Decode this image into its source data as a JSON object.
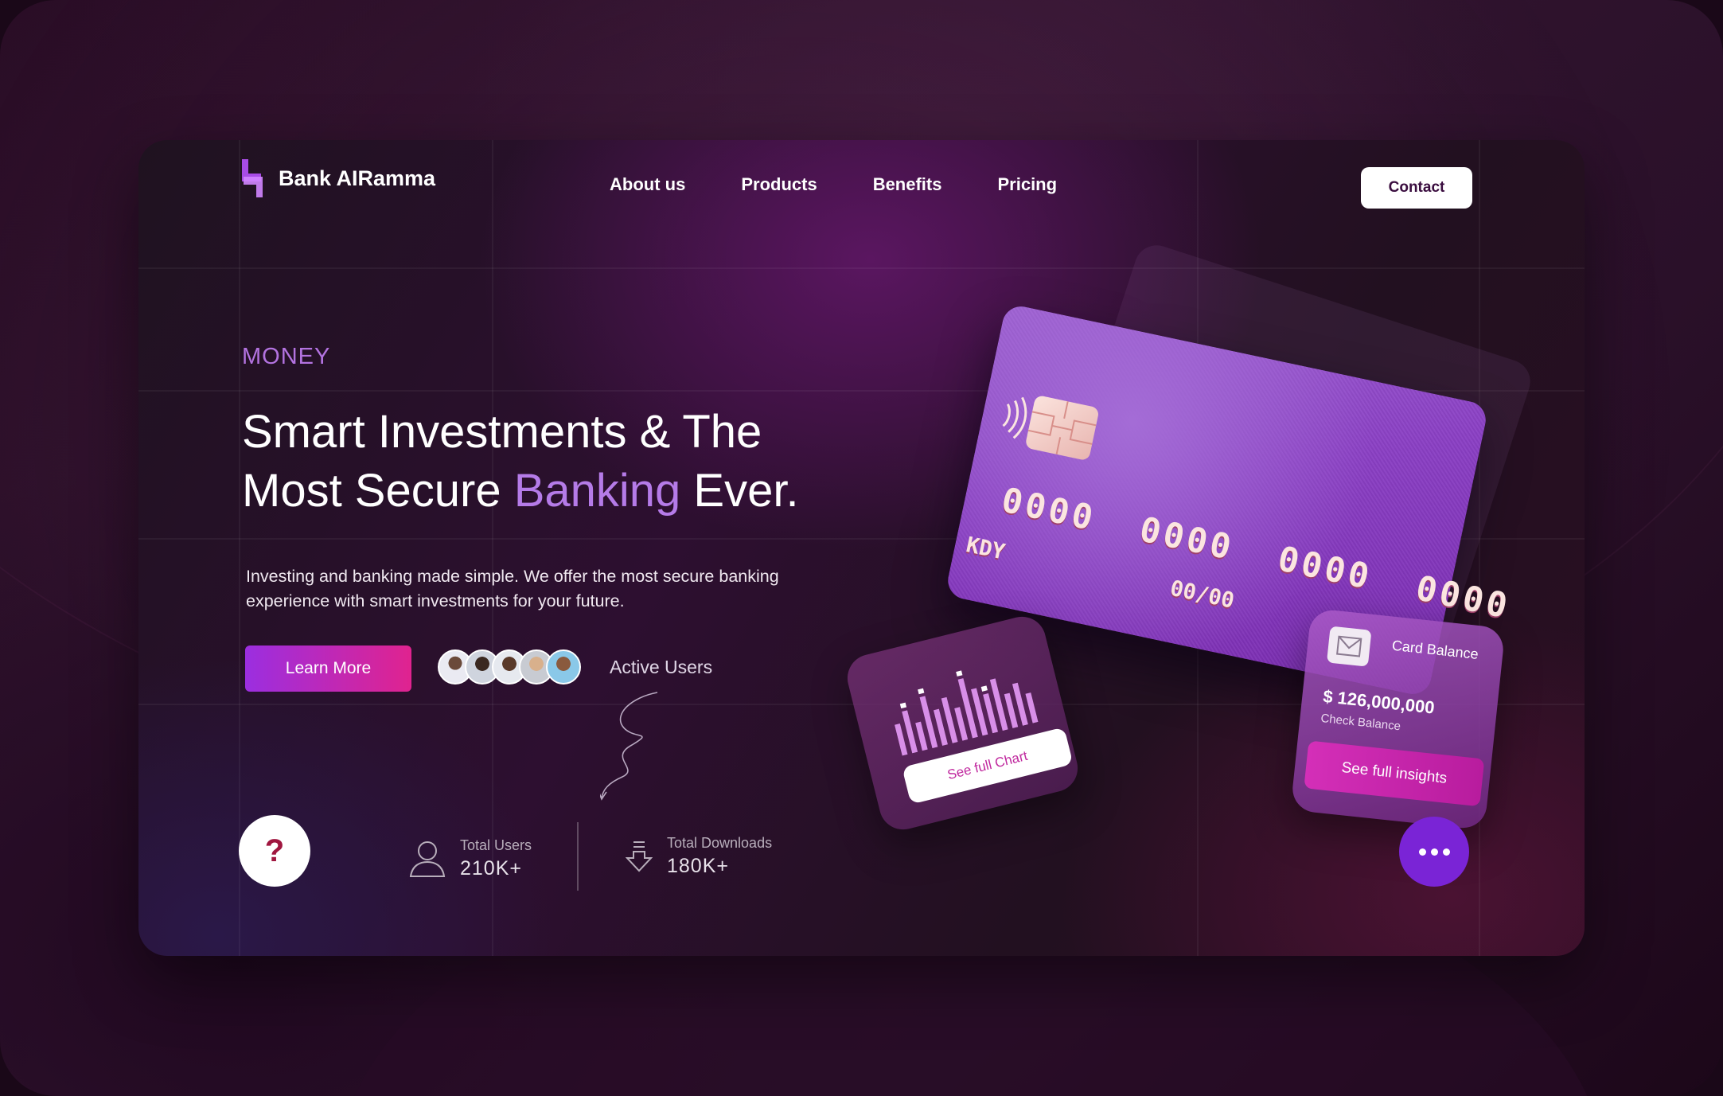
{
  "brand": {
    "name": "Bank AIRamma",
    "accent": "#9b3ee0"
  },
  "nav": {
    "items": [
      "About us",
      "Products",
      "Benefits",
      "Pricing"
    ],
    "contact_label": "Contact"
  },
  "hero": {
    "eyebrow": "MONEY",
    "headline_line1": "Smart Investments & The",
    "headline_line2_prefix": "Most Secure ",
    "headline_accent": "Banking",
    "headline_line2_suffix": " Ever.",
    "subtext": "Investing and banking made simple. We offer the most secure banking experience with smart investments for your future.",
    "learn_more_label": "Learn More",
    "active_users_label": "Active Users"
  },
  "stats": [
    {
      "icon": "user-icon",
      "label": "Total Users",
      "value": "210K+"
    },
    {
      "icon": "download-icon",
      "label": "Total Downloads",
      "value": "180K+"
    }
  ],
  "help_label": "?",
  "credit_card": {
    "number": "0000 0000 0000 0000",
    "expiry": "00/00",
    "holder": "KDY"
  },
  "chart_widget": {
    "button_label": "See full Chart"
  },
  "balance_widget": {
    "title": "Card Balance",
    "amount": "$ 126,000,000",
    "subtitle": "Check Balance",
    "button_label": "See full insights"
  },
  "colors": {
    "accent_purple": "#b57be8",
    "button_gradient_start": "#9b2ee0",
    "button_gradient_end": "#e0238f",
    "more_button": "#7a24d6",
    "help_question": "#a0163f"
  }
}
